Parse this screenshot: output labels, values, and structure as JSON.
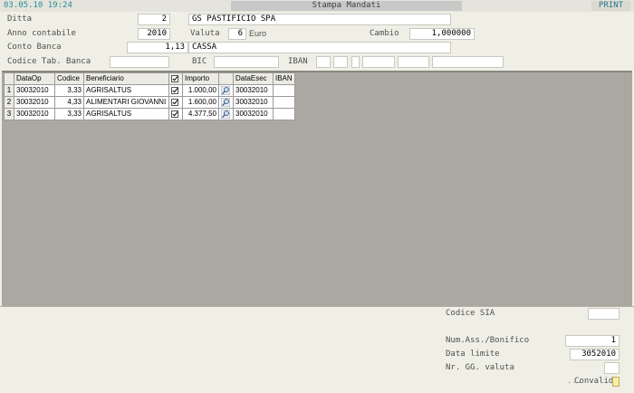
{
  "topbar": {
    "datetime": "03.05.10 19:24",
    "title": "Stampa Mandati",
    "print": "PRINT"
  },
  "form": {
    "ditta_label": "Ditta",
    "ditta_code": "2",
    "ditta_name": "GS PASTIFICIO SPA",
    "anno_label": "Anno contabile",
    "anno_value": "2010",
    "valuta_label": "Valuta",
    "valuta_code": "6",
    "valuta_name": "Euro",
    "cambio_label": "Cambio",
    "cambio_value": "1,000000",
    "conto_label": "Conto Banca",
    "conto_code": "1,13",
    "conto_name": "CASSA",
    "codtab_label": "Codice Tab. Banca",
    "codtab_value": "",
    "bic_label": "BIC",
    "bic_value": "",
    "iban_label": "IBAN",
    "iban_parts": [
      "",
      "",
      "",
      "",
      "",
      ""
    ]
  },
  "grid": {
    "columns": [
      "DataOp",
      "Codice",
      "Beneficiario",
      "check",
      "Importo",
      "icon",
      "DataEsec",
      "IBAN"
    ],
    "rows": [
      {
        "n": "1",
        "dataop": "30032010",
        "codice": "3,33",
        "benef": "AGRISALTUS",
        "checked": true,
        "importo": "1.000,00",
        "dataesec": "30032010",
        "iban": ""
      },
      {
        "n": "2",
        "dataop": "30032010",
        "codice": "4,33",
        "benef": "ALIMENTARI GIOVANNI",
        "checked": true,
        "importo": "1.600,00",
        "dataesec": "30032010",
        "iban": ""
      },
      {
        "n": "3",
        "dataop": "30032010",
        "codice": "3,33",
        "benef": "AGRISALTUS",
        "checked": true,
        "importo": "4.377,50",
        "dataesec": "30032010",
        "iban": ""
      }
    ]
  },
  "bottom": {
    "sia_label": "Codice SIA",
    "sia_value": "",
    "numass_label": "Num.Ass./Bonifico",
    "numass_value": "1",
    "datalim_label": "Data limite",
    "datalim_value": "3052010",
    "nrgg_label": "Nr. GG. valuta",
    "nrgg_value": "",
    "convalida_label": "Convalida",
    "convalida_prefix": "..."
  },
  "colors": {
    "accent": "#2a8a9a",
    "grid_bg": "#aaa8a1",
    "window_bg": "#efefe6"
  },
  "icons": {
    "row_action": "magnifier-icon",
    "check": "checkbox-icon"
  }
}
